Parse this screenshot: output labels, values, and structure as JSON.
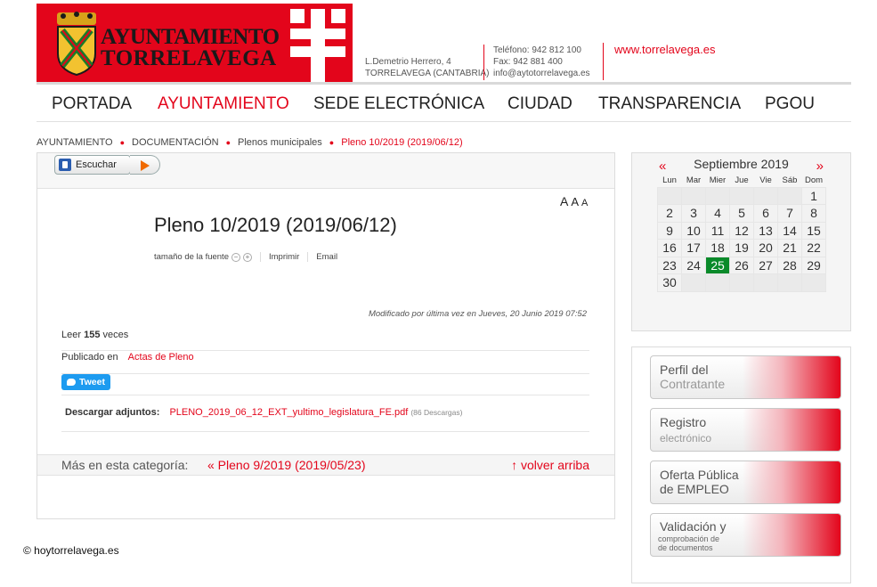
{
  "header": {
    "logo_line1": "AYUNTAMIENTO",
    "logo_line2": "TORRELAVEGA",
    "address_line1": "L.Demetrio Herrero, 4",
    "address_line2": "TORRELAVEGA (CANTABRIA)",
    "phone": "Teléfono: 942 812 100",
    "fax": "Fax: 942 881 400",
    "email": "info@aytotorrelavega.es",
    "website": "www.torrelavega.es",
    "brand_color": "#e3051b"
  },
  "nav": {
    "items": [
      "PORTADA",
      "AYUNTAMIENTO",
      "SEDE ELECTRÓNICA",
      "CIUDAD",
      "TRANSPARENCIA",
      "PGOU"
    ],
    "active": "AYUNTAMIENTO"
  },
  "breadcrumb": [
    "AYUNTAMIENTO",
    "DOCUMENTACIÓN",
    "Plenos municipales",
    "Pleno 10/2019 (2019/06/12)"
  ],
  "toolbar": {
    "listen_label": "Escuchar"
  },
  "article": {
    "font_controls": [
      "A",
      "A",
      "A"
    ],
    "title": "Pleno 10/2019 (2019/06/12)",
    "font_size_label": "tamaño de la fuente",
    "font_minus": "−",
    "font_plus": "+",
    "print_label": "Imprimir",
    "email_label": "Email",
    "modified": "Modificado por última vez en Jueves, 20 Junio 2019 07:52",
    "hits_prefix": "Leer",
    "hits_count": "155",
    "hits_suffix": "veces",
    "published_label": "Publicado en",
    "published_category": "Actas de Pleno",
    "tweet_label": "Tweet",
    "attachments_label": "Descargar adjuntos:",
    "attachment_file": "PLENO_2019_06_12_EXT_yultimo_legislatura_FE.pdf",
    "attachment_downloads": "(86 Descargas)",
    "more_label": "Más en esta categoría:",
    "prev_link": "« Pleno 9/2019 (2019/05/23)",
    "back_to_top": "↑ volver arriba"
  },
  "calendar": {
    "prev": "«",
    "next": "»",
    "month": "Septiembre 2019",
    "weekdays": [
      "Lun",
      "Mar",
      "Mier",
      "Jue",
      "Vie",
      "Sáb",
      "Dom"
    ],
    "weeks": [
      [
        "",
        "",
        "",
        "",
        "",
        "",
        "1"
      ],
      [
        "2",
        "3",
        "4",
        "5",
        "6",
        "7",
        "8"
      ],
      [
        "9",
        "10",
        "11",
        "12",
        "13",
        "14",
        "15"
      ],
      [
        "16",
        "17",
        "18",
        "19",
        "20",
        "21",
        "22"
      ],
      [
        "23",
        "24",
        "25",
        "26",
        "27",
        "28",
        "29"
      ],
      [
        "30",
        "",
        "",
        "",
        "",
        "",
        ""
      ]
    ],
    "today": "25",
    "today_color": "#0a8a2a"
  },
  "banners": {
    "perfil_t1": "Perfil del",
    "perfil_t2": "Contratante",
    "registro_t1": "Registro",
    "registro_t2": "electrónico",
    "oferta_t1": "Oferta Pública",
    "oferta_t2": "de EMPLEO",
    "valid_t1": "Validación y",
    "valid_s1": "comprobación de",
    "valid_s2": "de documentos"
  },
  "copyright": "© hoytorrelavega.es"
}
